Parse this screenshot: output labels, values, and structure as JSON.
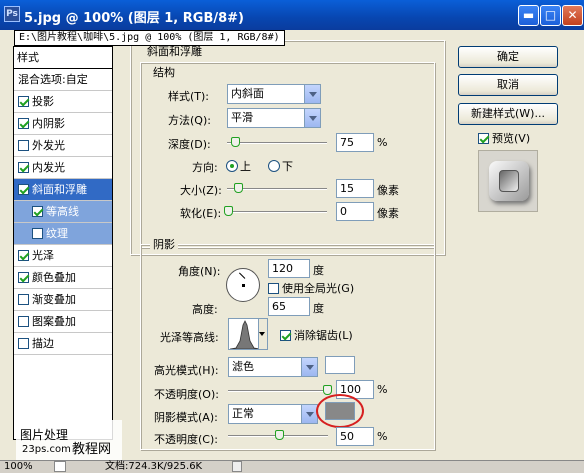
{
  "window": {
    "title": "5.jpg @ 100% (图层 1, RGB/8#)",
    "icon_label": "Ps",
    "path_tooltip": "E:\\图片教程\\咖啡\\5.jpg @ 100% (图层 1, RGB/8#)"
  },
  "styles_panel": {
    "header": "样式",
    "blend_options": "混合选项:自定",
    "items": [
      {
        "label": "投影",
        "checked": true
      },
      {
        "label": "内阴影",
        "checked": true
      },
      {
        "label": "外发光",
        "checked": false
      },
      {
        "label": "内发光",
        "checked": true
      },
      {
        "label": "斜面和浮雕",
        "checked": true,
        "selected": true
      },
      {
        "label": "等高线",
        "checked": true,
        "sub": true
      },
      {
        "label": "纹理",
        "checked": false,
        "sub": true
      },
      {
        "label": "光泽",
        "checked": true
      },
      {
        "label": "颜色叠加",
        "checked": true
      },
      {
        "label": "渐变叠加",
        "checked": false
      },
      {
        "label": "图案叠加",
        "checked": false
      },
      {
        "label": "描边",
        "checked": false
      }
    ]
  },
  "bevel": {
    "section_title": "斜面和浮雕",
    "structure_title": "结构",
    "style_label": "样式(T):",
    "style_value": "内斜面",
    "technique_label": "方法(Q):",
    "technique_value": "平滑",
    "depth_label": "深度(D):",
    "depth_value": "75",
    "percent": "%",
    "direction_label": "方向:",
    "direction_up": "上",
    "direction_down": "下",
    "size_label": "大小(Z):",
    "size_value": "15",
    "size_unit": "像素",
    "soften_label": "软化(E):",
    "soften_value": "0",
    "soften_unit": "像素"
  },
  "shading": {
    "title": "阴影",
    "angle_label": "角度(N):",
    "angle_value": "120",
    "degree": "度",
    "global_light_label": "使用全局光(G)",
    "global_light_checked": false,
    "altitude_label": "高度:",
    "altitude_value": "65",
    "gloss_contour_label": "光泽等高线:",
    "antialias_label": "消除锯齿(L)",
    "antialias_checked": true,
    "highlight_mode_label": "高光模式(H):",
    "highlight_mode_value": "滤色",
    "highlight_color": "#ffffff",
    "opacity1_label": "不透明度(O):",
    "opacity1_value": "100",
    "shadow_mode_label": "阴影模式(A):",
    "shadow_mode_value": "正常",
    "shadow_color": "#888888",
    "opacity2_label": "不透明度(C):",
    "opacity2_value": "50",
    "percent": "%"
  },
  "right_panel": {
    "ok": "确定",
    "cancel": "取消",
    "new_style": "新建样式(W)...",
    "preview_label": "预览(V)",
    "preview_checked": true
  },
  "status": {
    "zoom": "100%",
    "doc_info": "文档:724.3K/925.6K"
  },
  "watermark": {
    "line1": "图片处理",
    "line2": "教程网",
    "line3": "23ps.com"
  },
  "annotation_color": "#d62020"
}
